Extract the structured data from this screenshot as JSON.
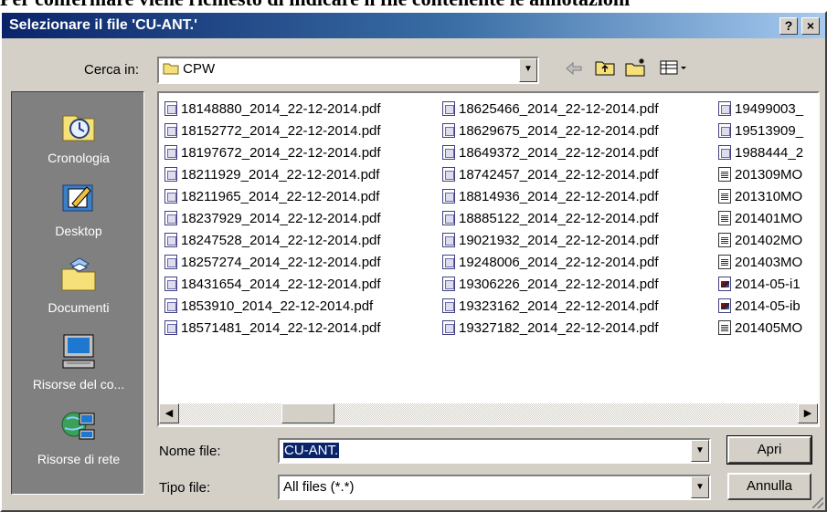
{
  "document_line": "Per confermare viene richiesto di indicare il file contenente le annotazioni",
  "dialog": {
    "title": "Selezionare il file 'CU-ANT.'",
    "help_glyph": "?",
    "close_glyph": "×"
  },
  "lookin": {
    "label": "Cerca in:",
    "value": "CPW"
  },
  "toolbar": {
    "back_icon": "back-arrow-icon",
    "up_icon": "up-folder-icon",
    "new_folder_icon": "new-folder-icon",
    "view_icon": "view-menu-icon"
  },
  "places": [
    {
      "label": "Cronologia",
      "icon": "history-icon"
    },
    {
      "label": "Desktop",
      "icon": "desktop-icon"
    },
    {
      "label": "Documenti",
      "icon": "my-documents-icon"
    },
    {
      "label": "Risorse del co...",
      "icon": "my-computer-icon"
    },
    {
      "label": "Risorse di rete",
      "icon": "network-icon"
    }
  ],
  "files": {
    "col1": [
      "18148880_2014_22-12-2014.pdf",
      "18152772_2014_22-12-2014.pdf",
      "18197672_2014_22-12-2014.pdf",
      "18211929_2014_22-12-2014.pdf",
      "18211965_2014_22-12-2014.pdf",
      "18237929_2014_22-12-2014.pdf",
      "18247528_2014_22-12-2014.pdf",
      "18257274_2014_22-12-2014.pdf",
      "18431654_2014_22-12-2014.pdf",
      "1853910_2014_22-12-2014.pdf",
      "18571481_2014_22-12-2014.pdf"
    ],
    "col2": [
      "18625466_2014_22-12-2014.pdf",
      "18629675_2014_22-12-2014.pdf",
      "18649372_2014_22-12-2014.pdf",
      "18742457_2014_22-12-2014.pdf",
      "18814936_2014_22-12-2014.pdf",
      "18885122_2014_22-12-2014.pdf",
      "19021932_2014_22-12-2014.pdf",
      "19248006_2014_22-12-2014.pdf",
      "19306226_2014_22-12-2014.pdf",
      "19323162_2014_22-12-2014.pdf",
      "19327182_2014_22-12-2014.pdf"
    ],
    "col3": [
      "19499003_",
      "19513909_",
      "1988444_2",
      "201309MO",
      "201310MO",
      "201401MO",
      "201402MO",
      "201403MO",
      "2014-05-i1",
      "2014-05-ib",
      "201405MO"
    ],
    "col3_types": [
      "pdf",
      "pdf",
      "pdf",
      "txt",
      "txt",
      "txt",
      "txt",
      "txt",
      "img",
      "img",
      "txt"
    ]
  },
  "filename": {
    "label": "Nome file:",
    "value": "CU-ANT."
  },
  "filetype": {
    "label": "Tipo file:",
    "value": "All files (*.*)"
  },
  "buttons": {
    "open": "Apri",
    "cancel": "Annulla"
  }
}
